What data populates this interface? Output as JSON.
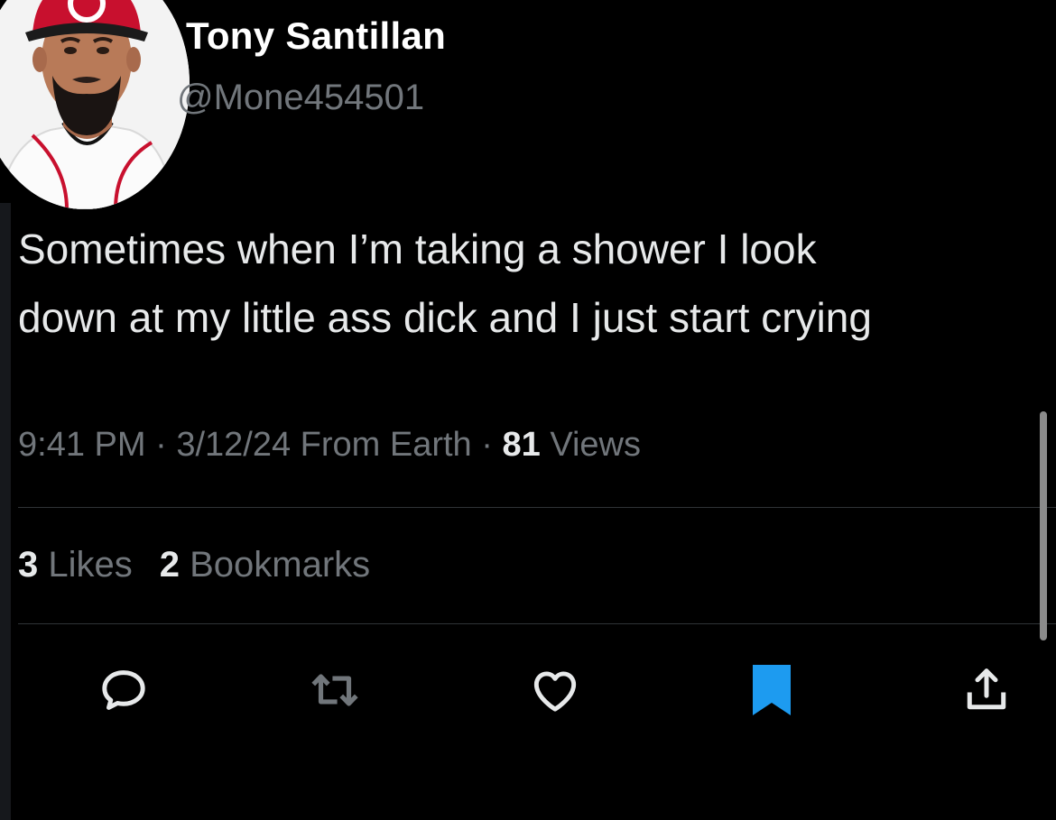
{
  "tweet": {
    "author": {
      "display_name": "Tony Santillan",
      "handle": "@Mone454501"
    },
    "text_lines": [
      "Sometimes when I’m taking a shower I look",
      "down at my little ass dick and I just start crying"
    ],
    "meta": {
      "time": "9:41 PM",
      "separator": " · ",
      "date_source": "3/12/24 From Earth",
      "views_count": "81",
      "views_label": " Views"
    },
    "stats": {
      "likes_count": "3",
      "likes_label": " Likes",
      "bookmarks_count": "2",
      "bookmarks_label": " Bookmarks"
    },
    "actions": {
      "reply_icon": "speech-bubble-icon",
      "retweet_icon": "retweet-arrows-icon",
      "like_icon": "heart-outline-icon",
      "bookmark_icon": "bookmark-filled-icon",
      "share_icon": "share-upload-icon"
    }
  },
  "colors": {
    "background": "#000000",
    "primary_text": "#e7e9ea",
    "secondary_text": "#71767b",
    "divider": "#2f3336",
    "bookmark_active": "#1d9bf0"
  }
}
